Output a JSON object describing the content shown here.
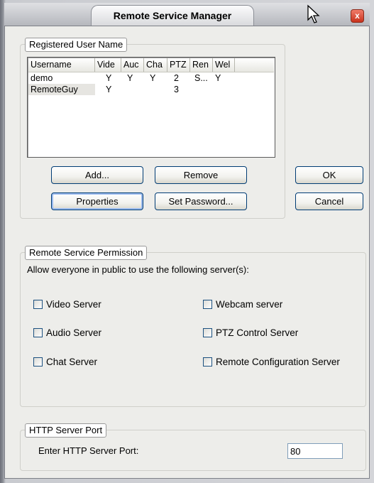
{
  "window": {
    "title": "Remote Service Manager",
    "close_glyph": "x"
  },
  "users_group": {
    "label": "Registered User Name",
    "columns": [
      "Username",
      "Vide",
      "Auc",
      "Cha",
      "PTZ",
      "Ren",
      "Wel"
    ],
    "rows": [
      {
        "username": "demo",
        "video": "Y",
        "audio": "Y",
        "chat": "Y",
        "ptz": "2",
        "remote": "S...",
        "webcam": "Y"
      },
      {
        "username": "RemoteGuy",
        "video": "Y",
        "audio": "",
        "chat": "",
        "ptz": "3",
        "remote": "",
        "webcam": ""
      }
    ],
    "buttons": {
      "add": "Add...",
      "remove": "Remove",
      "properties": "Properties",
      "set_password": "Set Password..."
    }
  },
  "dialog_buttons": {
    "ok": "OK",
    "cancel": "Cancel"
  },
  "permission_group": {
    "label": "Remote Service Permission",
    "description": "Allow everyone in public to use the following server(s):",
    "options": {
      "video_server": "Video Server",
      "audio_server": "Audio Server",
      "chat_server": "Chat Server",
      "webcam_server": "Webcam server",
      "ptz_control_server": "PTZ Control Server",
      "remote_configuration_server": "Remote Configuration Server"
    }
  },
  "http_group": {
    "label": "HTTP Server Port",
    "prompt": "Enter HTTP Server Port:",
    "port_value": "80"
  }
}
